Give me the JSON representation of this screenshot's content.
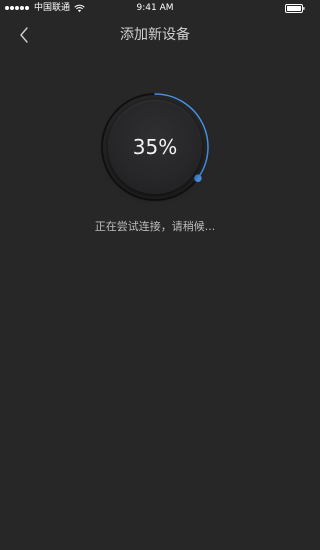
{
  "status_bar": {
    "carrier": "中国联通",
    "time": "9:41 AM",
    "signal_icon": "signal-dots-icon",
    "wifi_icon": "wifi-icon",
    "battery_icon": "battery-icon"
  },
  "nav": {
    "back_icon": "chevron-left-icon",
    "title": "添加新设备"
  },
  "progress": {
    "value_text": "35%",
    "fraction": 0.35,
    "accent_color": "#4a90e2"
  },
  "message": "正在尝试连接，请稍候..."
}
